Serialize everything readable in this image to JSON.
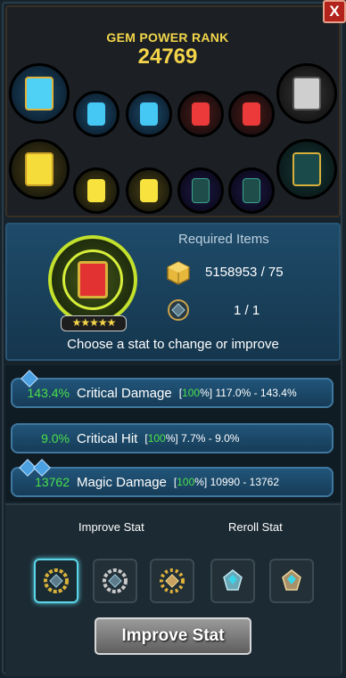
{
  "close_label": "X",
  "gem_power": {
    "title": "GEM POWER RANK",
    "value": "24769"
  },
  "gems": {
    "row1": [
      "blue-large",
      "blue",
      "blue",
      "red",
      "red",
      "grey-large"
    ],
    "row2": [
      "yellow-large",
      "yellow",
      "yellow",
      "purple",
      "purple",
      "teal-large"
    ]
  },
  "required": {
    "title": "Required Items",
    "items": [
      {
        "icon": "gold-cube-icon",
        "value": "5158953 / 75"
      },
      {
        "icon": "gem-core-icon",
        "value": "1 / 1"
      }
    ],
    "stars": "★★★★★"
  },
  "instruction": "Choose a stat to change or improve",
  "stats": [
    {
      "value": "143.4%",
      "name": "Critical Damage",
      "pct_open": "[",
      "pct": "100",
      "pct_close": "%]",
      "range": "117.0% - 143.4%"
    },
    {
      "value": "9.0%",
      "name": "Critical Hit",
      "pct_open": "[",
      "pct": "100",
      "pct_close": "%]",
      "range": "7.7% - 9.0%"
    },
    {
      "value": "13762",
      "name": "Magic Damage",
      "pct_open": "[",
      "pct": "100",
      "pct_close": "%]",
      "range": "10990 - 13762"
    }
  ],
  "bottom": {
    "improve_title": "Improve Stat",
    "reroll_title": "Reroll Stat",
    "button_label": "Improve Stat"
  },
  "colors": {
    "accent_green": "#4ae04a",
    "rank_gold": "#f4d44a",
    "selected_border": "#5ad6e8"
  }
}
